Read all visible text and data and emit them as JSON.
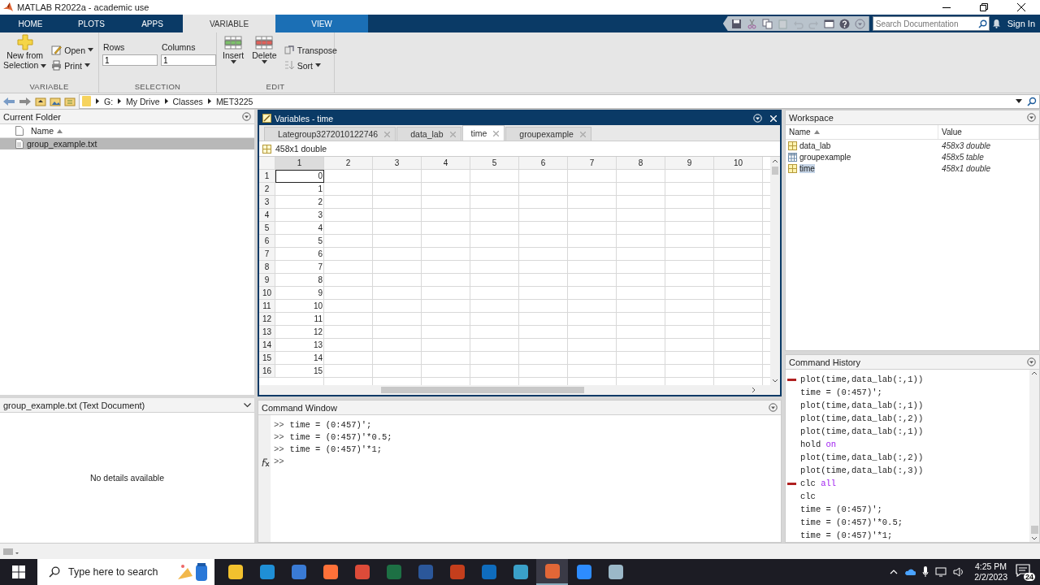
{
  "window": {
    "title": "MATLAB R2022a - academic use"
  },
  "ribbon": {
    "tabs": [
      {
        "label": "HOME",
        "selected": false,
        "contextual": false
      },
      {
        "label": "PLOTS",
        "selected": false,
        "contextual": false
      },
      {
        "label": "APPS",
        "selected": false,
        "contextual": false
      },
      {
        "label": "VARIABLE",
        "selected": true,
        "contextual": true
      },
      {
        "label": "VIEW",
        "selected": false,
        "contextual": true
      }
    ],
    "search": {
      "placeholder": "Search Documentation"
    },
    "sign_in": "Sign In",
    "groups": {
      "variable": {
        "label": "VARIABLE",
        "new_from_selection": "New from Selection",
        "open": "Open",
        "print": "Print"
      },
      "selection": {
        "label": "SELECTION",
        "rows_label": "Rows",
        "rows_value": "1",
        "columns_label": "Columns",
        "columns_value": "1"
      },
      "edit": {
        "label": "EDIT",
        "insert": "Insert",
        "delete": "Delete",
        "transpose": "Transpose",
        "sort": "Sort"
      }
    }
  },
  "address_bar": {
    "path": [
      "G:",
      "My Drive",
      "Classes",
      "MET3225"
    ]
  },
  "current_folder": {
    "title": "Current Folder",
    "column": "Name",
    "files": [
      {
        "name": "group_example.txt",
        "selected": true
      }
    ]
  },
  "details": {
    "title": "group_example.txt  (Text Document)",
    "message": "No details available"
  },
  "variables": {
    "title": "Variables - time",
    "tabs": [
      {
        "label": "Lategroup3272010122746",
        "selected": false
      },
      {
        "label": "data_lab",
        "selected": false
      },
      {
        "label": "time",
        "selected": true
      },
      {
        "label": "groupexample",
        "selected": false
      }
    ],
    "info": "458x1 double",
    "columns": [
      {
        "label": "1",
        "selected": true
      },
      {
        "label": "2",
        "selected": false
      },
      {
        "label": "3",
        "selected": false
      },
      {
        "label": "4",
        "selected": false
      },
      {
        "label": "5",
        "selected": false
      },
      {
        "label": "6",
        "selected": false
      },
      {
        "label": "7",
        "selected": false
      },
      {
        "label": "8",
        "selected": false
      },
      {
        "label": "9",
        "selected": false
      },
      {
        "label": "10",
        "selected": false
      }
    ],
    "rows": [
      {
        "header": "1",
        "value": "0",
        "selected": true
      },
      {
        "header": "2",
        "value": "1",
        "selected": false
      },
      {
        "header": "3",
        "value": "2",
        "selected": false
      },
      {
        "header": "4",
        "value": "3",
        "selected": false
      },
      {
        "header": "5",
        "value": "4",
        "selected": false
      },
      {
        "header": "6",
        "value": "5",
        "selected": false
      },
      {
        "header": "7",
        "value": "6",
        "selected": false
      },
      {
        "header": "8",
        "value": "7",
        "selected": false
      },
      {
        "header": "9",
        "value": "8",
        "selected": false
      },
      {
        "header": "10",
        "value": "9",
        "selected": false
      },
      {
        "header": "11",
        "value": "10",
        "selected": false
      },
      {
        "header": "12",
        "value": "11",
        "selected": false
      },
      {
        "header": "13",
        "value": "12",
        "selected": false
      },
      {
        "header": "14",
        "value": "13",
        "selected": false
      },
      {
        "header": "15",
        "value": "14",
        "selected": false
      },
      {
        "header": "16",
        "value": "15",
        "selected": false
      }
    ]
  },
  "command_window": {
    "title": "Command Window",
    "lines": [
      {
        "prompt": ">>",
        "code": "time = (0:457)';"
      },
      {
        "prompt": ">>",
        "code": "time = (0:457)'*0.5;"
      },
      {
        "prompt": ">>",
        "code": "time = (0:457)'*1;"
      }
    ],
    "current_prompt": ">>"
  },
  "workspace": {
    "title": "Workspace",
    "columns": [
      "Name",
      "Value"
    ],
    "variables": [
      {
        "name": "data_lab",
        "value": "458x3 double",
        "kind": "matrix",
        "selected": false
      },
      {
        "name": "groupexample",
        "value": "458x5 table",
        "kind": "table",
        "selected": false
      },
      {
        "name": "time",
        "value": "458x1 double",
        "kind": "matrix",
        "selected": true
      }
    ]
  },
  "command_history": {
    "title": "Command History",
    "entries": [
      {
        "code": "plot(time,data_lab(:,1))",
        "session_start": true
      },
      {
        "code": "time = (0:457)';",
        "session_start": false
      },
      {
        "code": "plot(time,data_lab(:,1))",
        "session_start": false
      },
      {
        "code": "plot(time,data_lab(:,2))",
        "session_start": false
      },
      {
        "code": "plot(time,data_lab(:,1))",
        "session_start": false
      },
      {
        "code": "hold",
        "argument": "on",
        "session_start": false
      },
      {
        "code": "plot(time,data_lab(:,2))",
        "session_start": false
      },
      {
        "code": "plot(time,data_lab(:,3))",
        "session_start": false
      },
      {
        "code": "clc",
        "argument": "all",
        "session_start": true
      },
      {
        "code": "clc",
        "session_start": false
      },
      {
        "code": "time = (0:457)';",
        "session_start": false
      },
      {
        "code": "time = (0:457)'*0.5;",
        "session_start": false
      },
      {
        "code": "time = (0:457)'*1;",
        "session_start": false
      }
    ]
  },
  "taskbar": {
    "search": {
      "placeholder": "Type here to search"
    },
    "apps": [
      {
        "color": "#f2c12e",
        "active": false
      },
      {
        "color": "#1f8fd6",
        "active": false
      },
      {
        "color": "#3a7bd5",
        "active": false
      },
      {
        "color": "#ff7139",
        "active": false
      },
      {
        "color": "#dd4b39",
        "active": false
      },
      {
        "color": "#1d7044",
        "active": false
      },
      {
        "color": "#2b579a",
        "active": false
      },
      {
        "color": "#c43e1c",
        "active": false
      },
      {
        "color": "#0f6cbd",
        "active": false
      },
      {
        "color": "#3aa0c8",
        "active": false
      },
      {
        "color": "#e16737",
        "active": true
      },
      {
        "color": "#2d8cff",
        "active": false
      },
      {
        "color": "#9bb8c8",
        "active": false
      }
    ],
    "time": "4:25 PM",
    "date": "2/2/2023",
    "notifications": "24"
  }
}
